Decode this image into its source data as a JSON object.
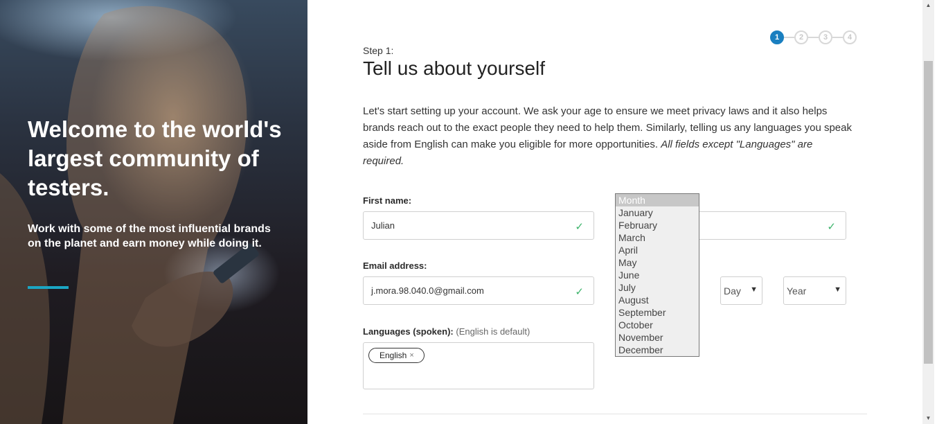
{
  "hero": {
    "title": "Welcome to the world's largest community of testers.",
    "subtitle": "Work with some of the most influential brands on the planet and earn money while doing it.",
    "accent_color": "#1ba6c4"
  },
  "stepper": {
    "steps": [
      "1",
      "2",
      "3",
      "4"
    ],
    "active_step": 1,
    "active_color": "#1a7fc0"
  },
  "form": {
    "step_label": "Step 1:",
    "title": "Tell us about yourself",
    "intro": "Let's start setting up your account. We ask your age to ensure we meet privacy laws and it also helps brands reach out to the exact people they need to help them. Similarly, telling us any languages you speak aside from English can make you eligible for more opportunities. ",
    "intro_emphasis": "All fields except \"Languages\" are required.",
    "first_name": {
      "label": "First name:",
      "value": "Julian",
      "valid_icon": "check-icon"
    },
    "last_name": {
      "value": "",
      "valid_icon": "check-icon"
    },
    "email": {
      "label": "Email address:",
      "value": "j.mora.98.040.0@gmail.com",
      "valid_icon": "check-icon"
    },
    "birth_day": {
      "selected": "Day"
    },
    "birth_year": {
      "selected": "Year"
    },
    "languages": {
      "label": "Languages (spoken):",
      "hint": "(English is default)",
      "tags": [
        "English"
      ],
      "remove_glyph": "×"
    },
    "month_dropdown": {
      "options": [
        "Month",
        "January",
        "February",
        "March",
        "April",
        "May",
        "June",
        "July",
        "August",
        "September",
        "October",
        "November",
        "December"
      ],
      "selected_index": 0
    },
    "valid_color": "#3bb36a"
  }
}
